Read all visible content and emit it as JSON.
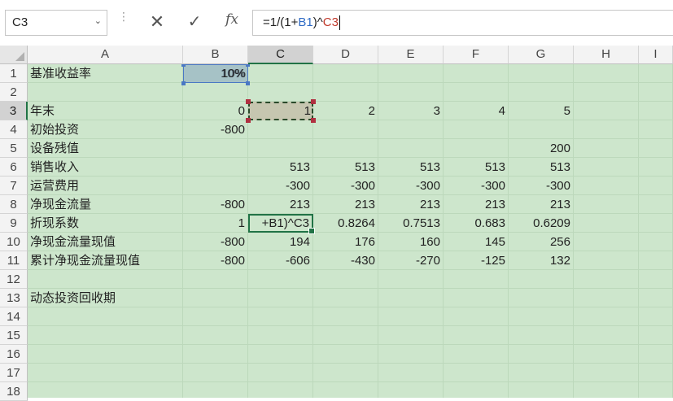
{
  "namebox": {
    "value": "C3",
    "arrow": "⌄"
  },
  "formula_bar": {
    "dots": "⋮",
    "cancel_icon": "✕",
    "enter_icon": "✓",
    "fx_label": "fx",
    "parts": [
      "=1/(1+",
      "B1",
      ")^",
      "C3"
    ]
  },
  "columns": [
    "A",
    "B",
    "C",
    "D",
    "E",
    "F",
    "G",
    "H",
    "I"
  ],
  "rows": [
    "1",
    "2",
    "3",
    "4",
    "5",
    "6",
    "7",
    "8",
    "9",
    "10",
    "11",
    "12",
    "13",
    "14",
    "15",
    "16",
    "17",
    "18"
  ],
  "cells": {
    "A1": "基准收益率",
    "B1": "10%",
    "A3": "年末",
    "B3": "0",
    "C3": "1",
    "D3": "2",
    "E3": "3",
    "F3": "4",
    "G3": "5",
    "A4": "初始投资",
    "B4": "-800",
    "A5": "设备残值",
    "G5": "200",
    "A6": "销售收入",
    "C6": "513",
    "D6": "513",
    "E6": "513",
    "F6": "513",
    "G6": "513",
    "A7": "运营费用",
    "C7": "-300",
    "D7": "-300",
    "E7": "-300",
    "F7": "-300",
    "G7": "-300",
    "A8": "净现金流量",
    "B8": "-800",
    "C8": "213",
    "D8": "213",
    "E8": "213",
    "F8": "213",
    "G8": "213",
    "A9": "折现系数",
    "B9": "1",
    "D9": "0.8264",
    "E9": "0.7513",
    "F9": "0.683",
    "G9": "0.6209",
    "A10": "净现金流量现值",
    "B10": "-800",
    "C10": "194",
    "D10": "176",
    "E10": "160",
    "F10": "145",
    "G10": "256",
    "A11": "累计净现金流量现值",
    "B11": "-800",
    "C11": "-606",
    "D11": "-430",
    "E11": "-270",
    "F11": "-125",
    "G11": "132",
    "A13": "动态投资回收期"
  },
  "editing_cell": {
    "ref": "C9",
    "display": "+B1)^C3"
  },
  "colors": {
    "sheet_bg": "#cde6cc",
    "accent": "#217346",
    "ref_blue": "#2f6bc5",
    "ref_red": "#c0392b"
  }
}
